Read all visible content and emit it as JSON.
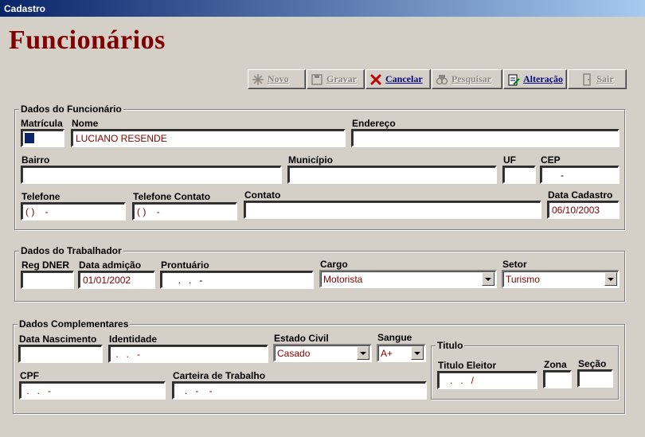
{
  "window": {
    "title": "Cadastro"
  },
  "page": {
    "heading": "Funcionários"
  },
  "toolbar": {
    "novo": "Novo",
    "gravar": "Gravar",
    "cancelar": "Cancelar",
    "pesquisar": "Pesquisar",
    "alteracao": "Alteração",
    "sair": "Sair"
  },
  "funcionario": {
    "legend": "Dados do Funcionário",
    "matricula_label": "Matrícula",
    "matricula": "",
    "nome_label": "Nome",
    "nome": "LUCIANO RESENDE",
    "endereco_label": "Endereço",
    "endereco": "",
    "bairro_label": "Bairro",
    "bairro": "",
    "municipio_label": "Município",
    "municipio": "",
    "uf_label": "UF",
    "uf": "",
    "cep_label": "CEP",
    "cep": "      -",
    "telefone_label": "Telefone",
    "telefone": "( )    -",
    "telefone_contato_label": "Telefone Contato",
    "telefone_contato": "( )    -",
    "contato_label": "Contato",
    "contato": "",
    "data_cadastro_label": "Data Cadastro",
    "data_cadastro": "06/10/2003"
  },
  "trabalhador": {
    "legend": "Dados do Trabalhador",
    "reg_dner_label": "Reg DNER",
    "reg_dner": "",
    "data_admicao_label": "Data admição",
    "data_admicao": "01/01/2002",
    "prontuario_label": "Prontuário",
    "prontuario": "     .   .   -",
    "cargo_label": "Cargo",
    "cargo": "Motorista",
    "setor_label": "Setor",
    "setor": "Turismo"
  },
  "complementares": {
    "legend": "Dados Complementares",
    "data_nascimento_label": "Data Nascimento",
    "data_nascimento": "",
    "identidade_label": "Identidade",
    "identidade": " .   .   -",
    "estado_civil_label": "Estado Civil",
    "estado_civil": "Casado",
    "sangue_label": "Sangue",
    "sangue": "A+",
    "cpf_label": "CPF",
    "cpf": " .   .   -",
    "carteira_label": "Carteira de Trabalho",
    "carteira": "   .   -    -",
    "titulo_legend": "Titulo",
    "titulo_eleitor_label": "Titulo Eleitor",
    "titulo_eleitor": "   .   .   /",
    "zona_label": "Zona",
    "zona": "",
    "secao_label": "Seção",
    "secao": ""
  }
}
